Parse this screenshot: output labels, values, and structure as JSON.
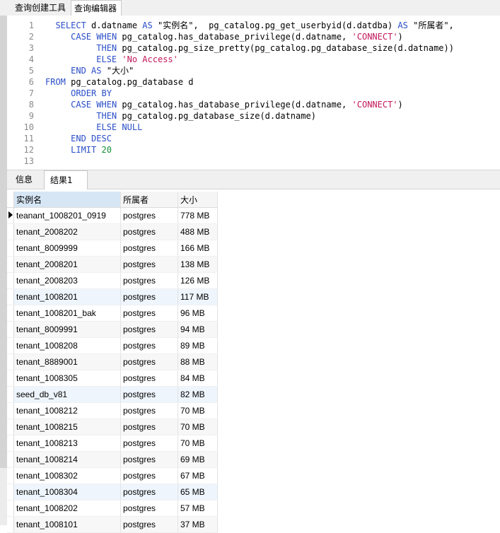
{
  "top_tabs": [
    {
      "label": "查询创建工具"
    },
    {
      "label": "查询编辑器"
    }
  ],
  "editor": {
    "line_numbers": [
      "1",
      "2",
      "3",
      "4",
      "5",
      "6",
      "7",
      "8",
      "9",
      "10",
      "11",
      "12",
      "13"
    ],
    "lines": [
      [
        {
          "t": "  "
        },
        {
          "t": "SELECT",
          "c": "kw"
        },
        {
          "t": " d.datname "
        },
        {
          "t": "AS",
          "c": "kw"
        },
        {
          "t": " \"实例名\",  pg_catalog.pg_get_userbyid(d.datdba) "
        },
        {
          "t": "AS",
          "c": "kw"
        },
        {
          "t": " \"所属者\","
        }
      ],
      [
        {
          "t": "     "
        },
        {
          "t": "CASE",
          "c": "kw"
        },
        {
          "t": " "
        },
        {
          "t": "WHEN",
          "c": "kw"
        },
        {
          "t": " pg_catalog.has_database_privilege(d.datname, "
        },
        {
          "t": "'CONNECT'",
          "c": "str"
        },
        {
          "t": ")"
        }
      ],
      [
        {
          "t": "          "
        },
        {
          "t": "THEN",
          "c": "kw"
        },
        {
          "t": " pg_catalog.pg_size_pretty(pg_catalog.pg_database_size(d.datname))"
        }
      ],
      [
        {
          "t": "          "
        },
        {
          "t": "ELSE",
          "c": "kw"
        },
        {
          "t": " "
        },
        {
          "t": "'No Access'",
          "c": "str"
        }
      ],
      [
        {
          "t": "     "
        },
        {
          "t": "END",
          "c": "kw"
        },
        {
          "t": " "
        },
        {
          "t": "AS",
          "c": "kw"
        },
        {
          "t": " \"大小\""
        }
      ],
      [
        {
          "t": "FROM",
          "c": "kw"
        },
        {
          "t": " pg_catalog.pg_database d"
        }
      ],
      [
        {
          "t": "     "
        },
        {
          "t": "ORDER BY",
          "c": "kw"
        }
      ],
      [
        {
          "t": "     "
        },
        {
          "t": "CASE",
          "c": "kw"
        },
        {
          "t": " "
        },
        {
          "t": "WHEN",
          "c": "kw"
        },
        {
          "t": " pg_catalog.has_database_privilege(d.datname, "
        },
        {
          "t": "'CONNECT'",
          "c": "str"
        },
        {
          "t": ")"
        }
      ],
      [
        {
          "t": "          "
        },
        {
          "t": "THEN",
          "c": "kw"
        },
        {
          "t": " pg_catalog.pg_database_size(d.datname)"
        }
      ],
      [
        {
          "t": "          "
        },
        {
          "t": "ELSE",
          "c": "kw"
        },
        {
          "t": " "
        },
        {
          "t": "NULL",
          "c": "kw"
        }
      ],
      [
        {
          "t": "     "
        },
        {
          "t": "END",
          "c": "kw"
        },
        {
          "t": " "
        },
        {
          "t": "DESC",
          "c": "kw"
        }
      ],
      [
        {
          "t": "     "
        },
        {
          "t": "LIMIT",
          "c": "kw"
        },
        {
          "t": " "
        },
        {
          "t": "20",
          "c": "num"
        }
      ],
      []
    ]
  },
  "panel_tabs": [
    {
      "label": "信息"
    },
    {
      "label": "结果1"
    }
  ],
  "results": {
    "columns": [
      "实例名",
      "所属者",
      "大小"
    ],
    "rows": [
      [
        "teanant_1008201_0919",
        "postgres",
        "778 MB"
      ],
      [
        "tenant_2008202",
        "postgres",
        "488 MB"
      ],
      [
        "tenant_8009999",
        "postgres",
        "166 MB"
      ],
      [
        "tenant_2008201",
        "postgres",
        "138 MB"
      ],
      [
        "tenant_2008203",
        "postgres",
        "126 MB"
      ],
      [
        "tenant_1008201",
        "postgres",
        "117 MB"
      ],
      [
        "tenant_1008201_bak",
        "postgres",
        "96 MB"
      ],
      [
        "tenant_8009991",
        "postgres",
        "94 MB"
      ],
      [
        "tenant_1008208",
        "postgres",
        "89 MB"
      ],
      [
        "tenant_8889001",
        "postgres",
        "88 MB"
      ],
      [
        "tenant_1008305",
        "postgres",
        "84 MB"
      ],
      [
        "seed_db_v81",
        "postgres",
        "82 MB"
      ],
      [
        "tenant_1008212",
        "postgres",
        "70 MB"
      ],
      [
        "tenant_1008215",
        "postgres",
        "70 MB"
      ],
      [
        "tenant_1008213",
        "postgres",
        "70 MB"
      ],
      [
        "tenant_1008214",
        "postgres",
        "69 MB"
      ],
      [
        "tenant_1008302",
        "postgres",
        "67 MB"
      ],
      [
        "tenant_1008304",
        "postgres",
        "65 MB"
      ],
      [
        "tenant_1008202",
        "postgres",
        "57 MB"
      ],
      [
        "tenant_1008101",
        "postgres",
        "37 MB"
      ]
    ]
  }
}
